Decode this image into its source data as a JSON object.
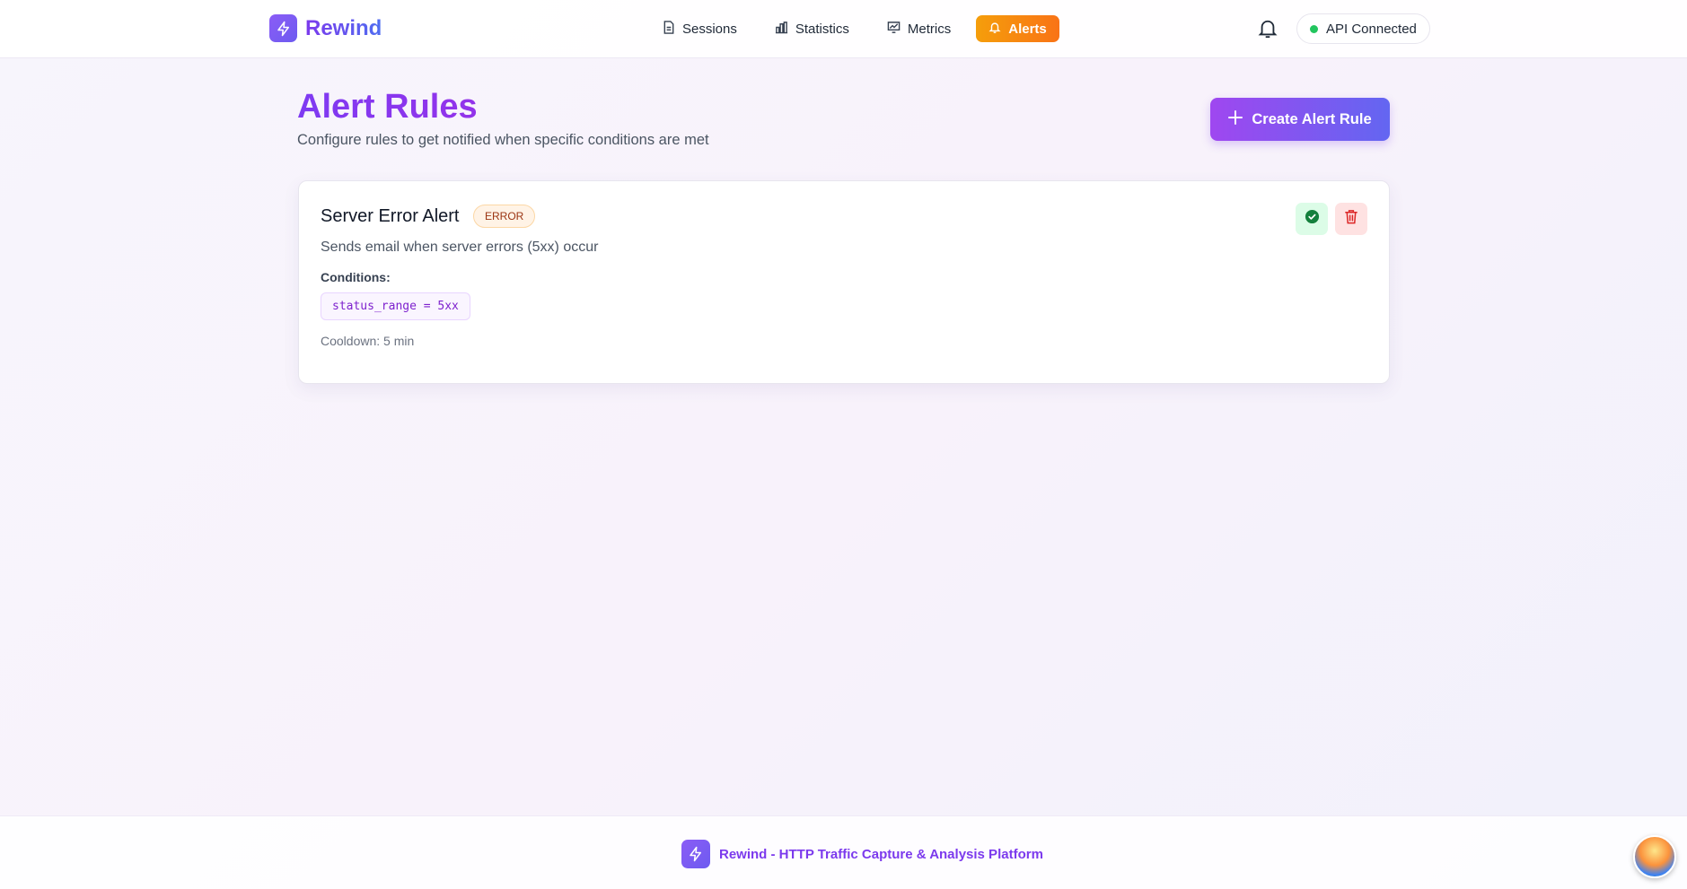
{
  "app": {
    "name": "Rewind"
  },
  "nav": [
    {
      "label": "Sessions",
      "icon": "document-icon"
    },
    {
      "label": "Statistics",
      "icon": "bar-chart-icon"
    },
    {
      "label": "Metrics",
      "icon": "line-chart-icon"
    },
    {
      "label": "Alerts",
      "icon": "bell-icon",
      "active": true
    }
  ],
  "header": {
    "api_status": "API Connected",
    "status_color": "#22c55e"
  },
  "page": {
    "title": "Alert Rules",
    "subtitle": "Configure rules to get notified when specific conditions are met",
    "create_button": "Create Alert Rule"
  },
  "rules": [
    {
      "name": "Server Error Alert",
      "severity": "ERROR",
      "description": "Sends email when server errors (5xx) occur",
      "conditions_label": "Conditions:",
      "condition": "status_range = 5xx",
      "cooldown": "Cooldown: 5 min",
      "enabled": true
    }
  ],
  "footer": {
    "text": "Rewind - HTTP Traffic Capture & Analysis Platform"
  },
  "colors": {
    "accent": "#7c3aed",
    "alerts_active": "#f97316",
    "success": "#15803d",
    "danger": "#dc2626"
  }
}
